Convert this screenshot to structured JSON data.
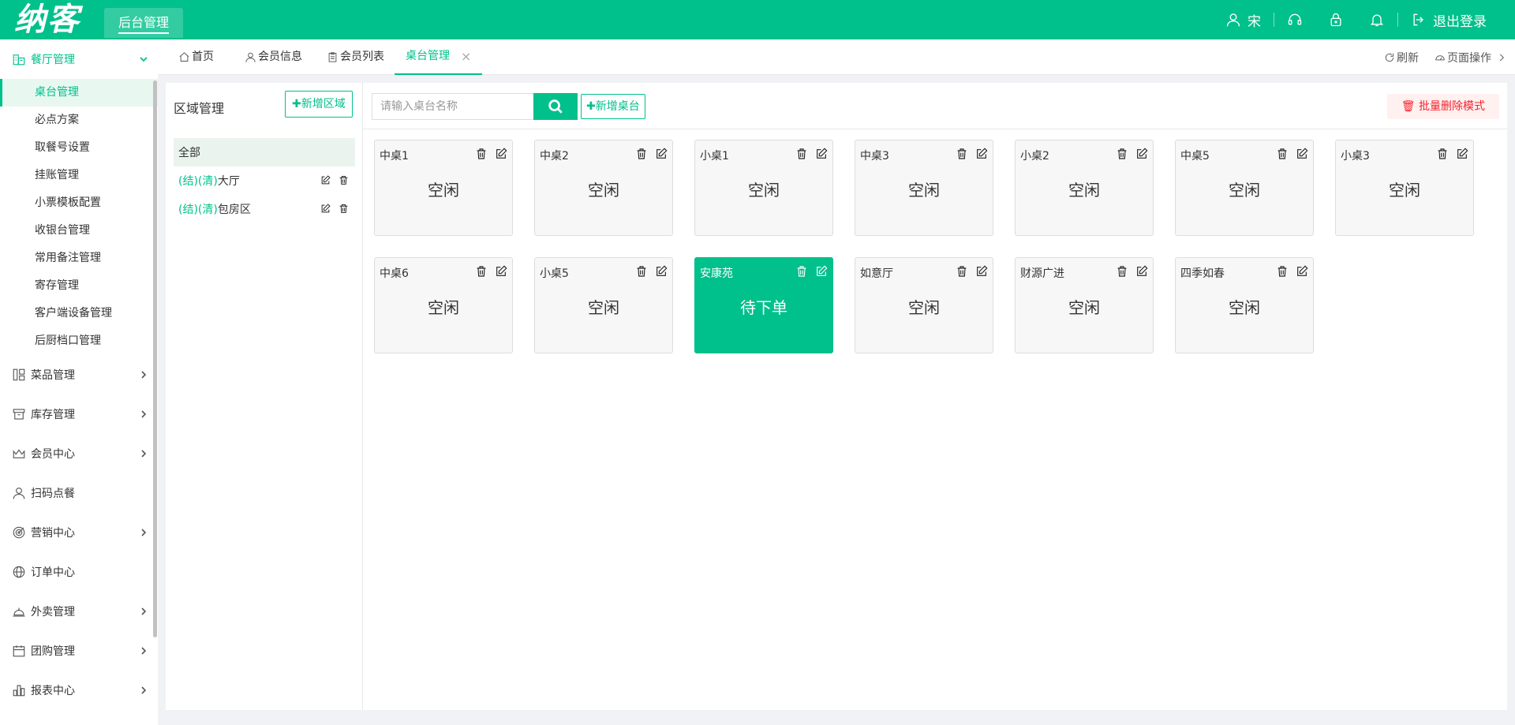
{
  "header": {
    "logo": "纳客",
    "top_tab": "后台管理",
    "user": "宋",
    "logout": "退出登录"
  },
  "sidebar": {
    "groups": [
      {
        "label": "餐厅管理",
        "icon": "restaurant-icon",
        "open": true
      },
      {
        "label": "菜品管理",
        "icon": "dishes-icon"
      },
      {
        "label": "库存管理",
        "icon": "inventory-icon"
      },
      {
        "label": "会员中心",
        "icon": "crown-icon"
      },
      {
        "label": "扫码点餐",
        "icon": "user-icon"
      },
      {
        "label": "营销中心",
        "icon": "target-icon"
      },
      {
        "label": "订单中心",
        "icon": "globe-icon"
      },
      {
        "label": "外卖管理",
        "icon": "bell-service-icon"
      },
      {
        "label": "团购管理",
        "icon": "calendar-icon"
      },
      {
        "label": "报表中心",
        "icon": "bar-chart-icon"
      }
    ],
    "sub_items": [
      "桌台管理",
      "必点方案",
      "取餐号设置",
      "挂账管理",
      "小票模板配置",
      "收银台管理",
      "常用备注管理",
      "寄存管理",
      "客户端设备管理",
      "后厨档口管理"
    ]
  },
  "tabs": {
    "home": "首页",
    "member_info": "会员信息",
    "member_list": "会员列表",
    "table_mgmt": "桌台管理",
    "close": "×",
    "refresh": "刷新",
    "page_ops": "页面操作"
  },
  "area": {
    "title": "区域管理",
    "add_button": "✚新增区域",
    "all": "全部",
    "rows": [
      {
        "tags": "(结)(清)",
        "name": "大厅"
      },
      {
        "tags": "(结)(清)",
        "name": "包房区"
      }
    ]
  },
  "main": {
    "search_placeholder": "请输入桌台名称",
    "add_table_button": "✚新增桌台",
    "batch_delete": "🗑 批量删除模式",
    "tables": [
      {
        "name": "中桌1",
        "status": "空闲"
      },
      {
        "name": "中桌2",
        "status": "空闲"
      },
      {
        "name": "小桌1",
        "status": "空闲"
      },
      {
        "name": "中桌3",
        "status": "空闲"
      },
      {
        "name": "小桌2",
        "status": "空闲"
      },
      {
        "name": "中桌5",
        "status": "空闲"
      },
      {
        "name": "小桌3",
        "status": "空闲"
      },
      {
        "name": "中桌6",
        "status": "空闲"
      },
      {
        "name": "小桌5",
        "status": "空闲"
      },
      {
        "name": "安康苑",
        "status": "待下单",
        "busy": true
      },
      {
        "name": "如意厅",
        "status": "空闲"
      },
      {
        "name": "财源广进",
        "status": "空闲"
      },
      {
        "name": "四季如春",
        "status": "空闲"
      }
    ]
  },
  "colors": {
    "brand": "#00c08b",
    "danger": "#f5222d"
  }
}
